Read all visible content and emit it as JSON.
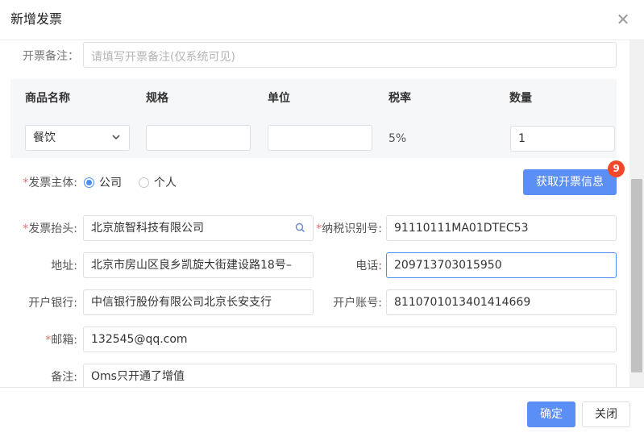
{
  "dialog": {
    "title": "新增发票"
  },
  "remark_top": {
    "label": "开票备注：",
    "placeholder": "请填写开票备注(仅系统可见)"
  },
  "table": {
    "headers": [
      "商品名称",
      "规格",
      "单位",
      "税率",
      "数量"
    ],
    "row": {
      "product": "餐饮",
      "spec": "",
      "unit": "",
      "tax_rate": "5%",
      "quantity": "1"
    }
  },
  "subject": {
    "label": "发票主体:",
    "options": [
      "公司",
      "个人"
    ],
    "selected": "公司",
    "fetch_button": "获取开票信息",
    "badge": "9"
  },
  "form": {
    "invoice_title": {
      "label": "发票抬头:",
      "value": "北京旅智科技有限公司"
    },
    "tax_id": {
      "label": "纳税识别号:",
      "value": "91110111MA01DTEC53"
    },
    "address": {
      "label": "地址:",
      "value": "北京市房山区良乡凯旋大街建设路18号–"
    },
    "phone": {
      "label": "电话:",
      "value": "209713703015950"
    },
    "bank": {
      "label": "开户银行:",
      "value": "中信银行股份有限公司北京长安支行"
    },
    "account": {
      "label": "开户账号:",
      "value": "8110701013401414669"
    },
    "email": {
      "label": "邮箱:",
      "value": "132545@qq.com"
    },
    "note": {
      "label": "备注:",
      "value": "Oms只开通了增值"
    }
  },
  "footer": {
    "confirm": "确定",
    "close": "关闭"
  },
  "colors": {
    "primary": "#5b8ff6",
    "required": "#f56c6c",
    "badge": "#f0482b"
  }
}
